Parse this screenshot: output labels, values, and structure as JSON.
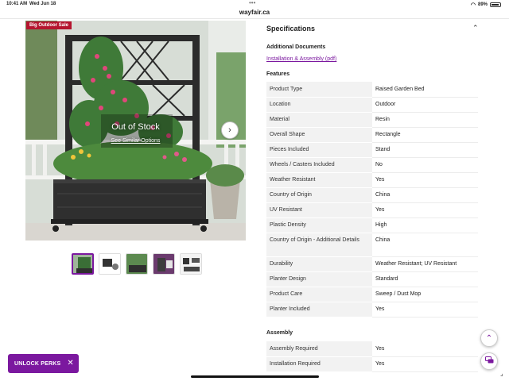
{
  "status": {
    "time": "10:41 AM",
    "date": "Wed Jun 18",
    "battery": "89%"
  },
  "browser": {
    "url": "wayfair.ca"
  },
  "product": {
    "badge": "Big Outdoor Sale",
    "out_of_stock": "Out of Stock",
    "similar_link": "See Similar Options"
  },
  "specifications": {
    "title": "Specifications",
    "additional_documents": "Additional Documents",
    "pdf_link": "Installation & Assembly (pdf)",
    "features_title": "Features",
    "features": [
      {
        "key": "Product Type",
        "value": "Raised Garden Bed"
      },
      {
        "key": "Location",
        "value": "Outdoor"
      },
      {
        "key": "Material",
        "value": "Resin"
      },
      {
        "key": "Overall Shape",
        "value": "Rectangle"
      },
      {
        "key": "Pieces Included",
        "value": "Stand"
      },
      {
        "key": "Wheels / Casters Included",
        "value": "No"
      },
      {
        "key": "Weather Resistant",
        "value": "Yes"
      },
      {
        "key": "Country of Origin",
        "value": "China"
      },
      {
        "key": "UV Resistant",
        "value": "Yes"
      },
      {
        "key": "Plastic Density",
        "value": "High"
      },
      {
        "key": "Country of Origin - Additional Details",
        "value": "China"
      },
      {
        "key": "Durability",
        "value": "Weather Resistant; UV Resistant"
      },
      {
        "key": "Planter Design",
        "value": "Standard"
      },
      {
        "key": "Product Care",
        "value": "Sweep / Dust Mop"
      },
      {
        "key": "Planter Included",
        "value": "Yes"
      }
    ],
    "assembly_title": "Assembly",
    "assembly": [
      {
        "key": "Assembly Required",
        "value": "Yes"
      },
      {
        "key": "Installation Required",
        "value": "Yes"
      }
    ]
  },
  "perks": {
    "label": "UNLOCK PERKS"
  },
  "colors": {
    "brand_purple": "#7b189f",
    "sale_red": "#b5152f"
  },
  "icons": {
    "next": "chevron-right-icon",
    "collapse": "chevron-up-icon",
    "scroll_top": "arrow-up-icon",
    "chat": "chat-icon",
    "close": "close-icon"
  }
}
